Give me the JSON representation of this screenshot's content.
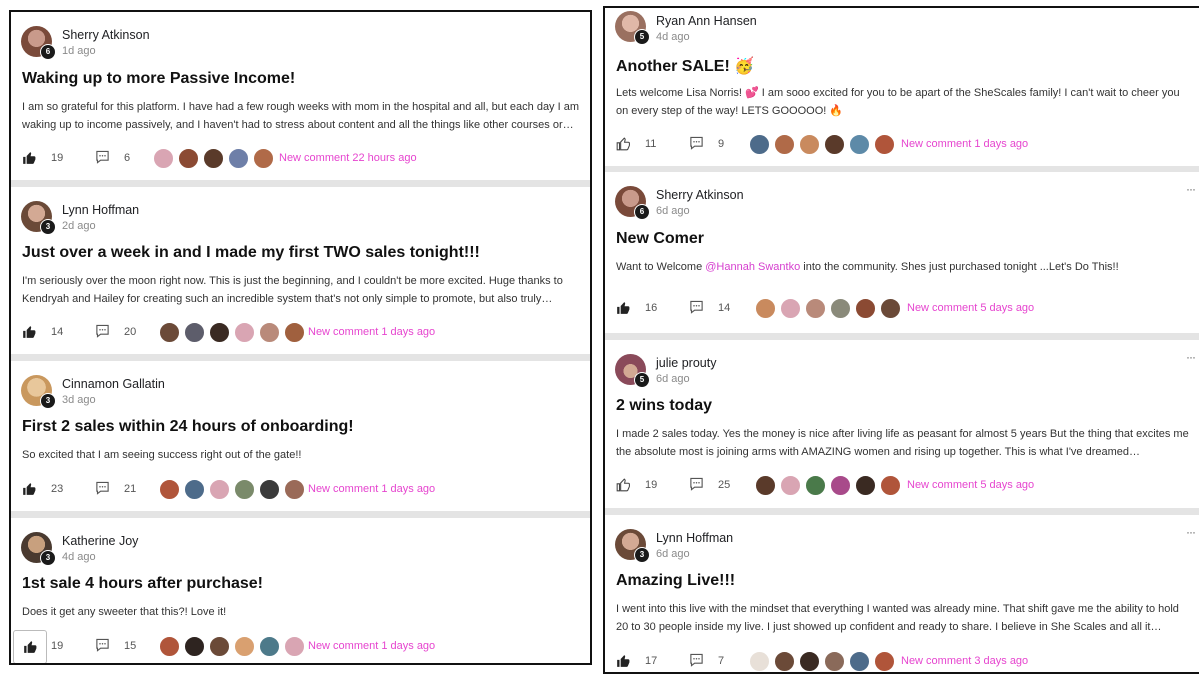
{
  "left_column": {
    "posts": [
      {
        "author": "Sherry Atkinson",
        "level": "6",
        "time": "1d ago",
        "title": "Waking up to more Passive Income!",
        "body": "I am so grateful for this platform. I have had a few rough weeks with mom in the hospital and all, but each day I am waking up to income passively, and I haven't had to stress about content and all the things like other courses or…",
        "likes": "19",
        "comments": "6",
        "new_comment": "New comment 22 hours ago"
      },
      {
        "author": "Lynn Hoffman",
        "level": "3",
        "time": "2d ago",
        "title": "Just over a week in and I made my first TWO sales tonight!!!",
        "body": "I'm seriously over the moon right now. This is just the beginning, and I couldn't be more excited. Huge thanks to Kendryah and Hailey for creating such an incredible system that's not only simple to promote, but also truly works…",
        "likes": "14",
        "comments": "20",
        "new_comment": "New comment 1 days ago"
      },
      {
        "author": "Cinnamon Gallatin",
        "level": "3",
        "time": "3d ago",
        "title": "First 2 sales within 24 hours of onboarding!",
        "body": "So excited that I am seeing success right out of the gate!!",
        "likes": "23",
        "comments": "21",
        "new_comment": "New comment 1 days ago"
      },
      {
        "author": "Katherine Joy",
        "level": "3",
        "time": "4d ago",
        "title": "1st sale 4 hours after purchase!",
        "body": "Does it get any sweeter that this?! Love it!",
        "likes": "19",
        "comments": "15",
        "new_comment": "New comment 1 days ago"
      }
    ]
  },
  "right_column": {
    "posts": [
      {
        "author": "Ryan Ann Hansen",
        "level": "5",
        "time": "4d ago",
        "title": "Another SALE! 🥳",
        "body": "Lets welcome Lisa Norris! 💕 I am sooo excited for you to be apart of the SheScales family! I can't wait to cheer you on every step of the way! LETS GOOOOO! 🔥",
        "likes": "11",
        "comments": "9",
        "new_comment": "New comment 1 days ago"
      },
      {
        "author": "Sherry Atkinson",
        "level": "6",
        "time": "6d ago",
        "title": "New Comer",
        "body_before": "Want to Welcome ",
        "mention": "@Hannah Swantko",
        "body_after": " into the community. Shes just purchased tonight ...Let's Do This!!",
        "likes": "16",
        "comments": "14",
        "new_comment": "New comment 5 days ago"
      },
      {
        "author": "julie prouty",
        "level": "5",
        "time": "6d ago",
        "title": "2 wins today",
        "body": "I made 2 sales today. Yes the money is nice after living life as peasant for almost 5 years But the thing that excites me the absolute most is joining arms with AMAZING women and rising up together. This is what I've dreamed…",
        "likes": "19",
        "comments": "25",
        "new_comment": "New comment 5 days ago"
      },
      {
        "author": "Lynn Hoffman",
        "level": "3",
        "time": "6d ago",
        "title": "Amazing Live!!!",
        "body": "I went into this live with the mindset that everything I wanted was already mine. That shift gave me the ability to hold 20 to 30 people inside my live. I just showed up confident and ready to share. I believe in She Scales and all it…",
        "likes": "17",
        "comments": "7",
        "new_comment": "New comment 3 days ago"
      }
    ]
  },
  "more_menu_glyph": "···",
  "colors": {
    "accent": "#e645cf",
    "mention": "#d63fcf",
    "background": "#e4e4e4"
  }
}
